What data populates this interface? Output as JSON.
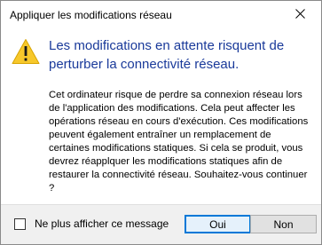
{
  "window": {
    "title": "Appliquer les modifications réseau"
  },
  "dialog": {
    "main_instruction": "Les modifications en attente risquent de perturber la connectivité réseau.",
    "content": "Cet ordinateur risque de perdre sa connexion réseau lors de l'application des modifications. Cela peut affecter les opérations réseau en cours d'exécution. Ces modifications peuvent également entraîner un remplacement de certaines modifications statiques. Si cela se produit, vous devrez réapplquer les modifications statiques afin de restaurer la connectivité réseau. Souhaitez-vous continuer ?",
    "icon": "warning-icon"
  },
  "footer": {
    "checkbox_label": "Ne plus afficher ce message",
    "checkbox_checked": false,
    "yes_label": "Oui",
    "no_label": "Non"
  },
  "colors": {
    "instruction": "#1a3a9a",
    "warning_fill": "#f7c82b",
    "focus_border": "#0078d7"
  }
}
